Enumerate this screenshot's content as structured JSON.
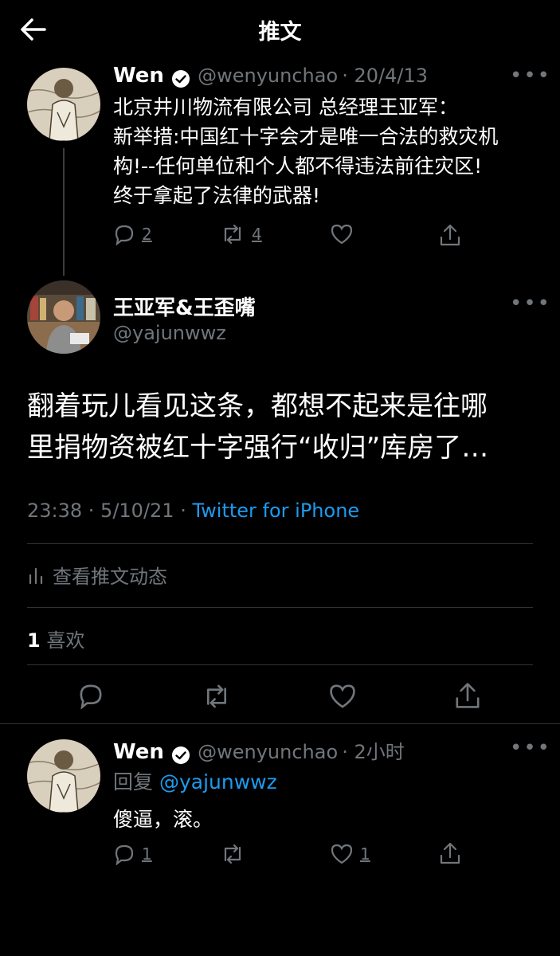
{
  "header": {
    "title": "推文"
  },
  "parent_tweet": {
    "name": "Wen",
    "handle": "@wenyunchao",
    "date": "· 20/4/13",
    "lines": [
      "北京井川物流有限公司 总经理王亚军：",
      "新举措:中国红十字会才是唯一合法的救灾机",
      "构!--任何单位和个人都不得违法前往灾区!",
      "终于拿起了法律的武器!"
    ],
    "replies": "2",
    "retweets": "4"
  },
  "main_tweet": {
    "name": "王亚军&王歪嘴",
    "handle": "@yajunwwz",
    "lines": [
      "翻着玩儿看见这条，都想不起来是往哪",
      "里捐物资被红十字强行“收归”库房了…"
    ],
    "time": "23:38 · 5/10/21 ·",
    "source": "Twitter for iPhone",
    "activity": "查看推文动态",
    "likes_count": "1",
    "likes_label": "喜欢"
  },
  "reply_tweet": {
    "name": "Wen",
    "handle": "@wenyunchao",
    "time": "· 2小时",
    "reply_prefix": "回复",
    "reply_to": "@yajunwwz",
    "text": "傻逼，滚。",
    "replies": "1",
    "likes": "1"
  },
  "icons": [
    "back-arrow-icon",
    "verified-icon",
    "more-icon",
    "reply-icon",
    "retweet-icon",
    "like-icon",
    "share-icon",
    "analytics-icon"
  ],
  "colors": {
    "background": "#000000",
    "link": "#1d9bf0",
    "muted": "#71767b",
    "verified": "#ffffff"
  }
}
